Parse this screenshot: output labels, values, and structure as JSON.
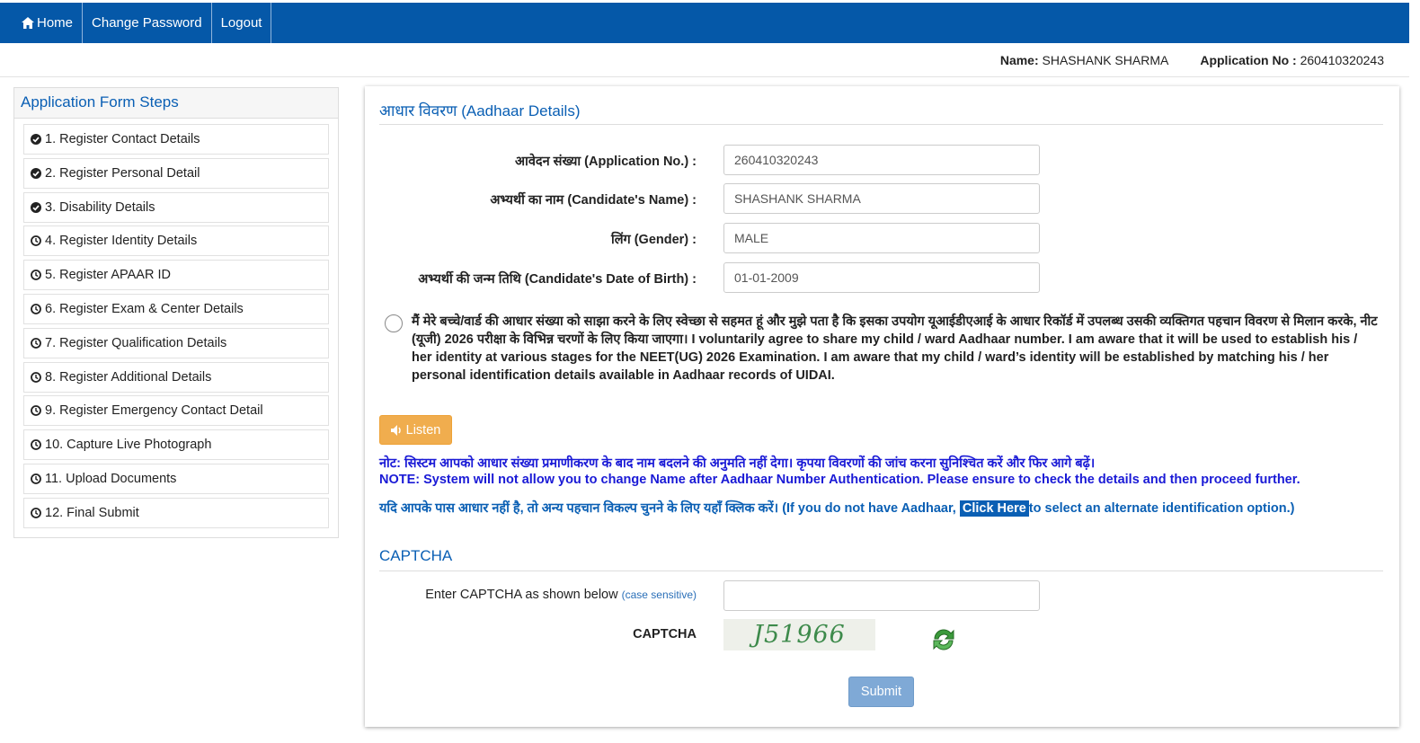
{
  "nav": {
    "home": "Home",
    "change_password": "Change Password",
    "logout": "Logout"
  },
  "user": {
    "name_label": "Name:",
    "name": "SHASHANK SHARMA",
    "app_label": "Application No :",
    "app_no": "260410320243"
  },
  "sidebar": {
    "title": "Application Form Steps",
    "steps": [
      {
        "label": "1. Register Contact Details",
        "status": "done"
      },
      {
        "label": "2. Register Personal Detail",
        "status": "done"
      },
      {
        "label": "3. Disability Details",
        "status": "done"
      },
      {
        "label": "4. Register Identity Details",
        "status": "pending"
      },
      {
        "label": "5. Register APAAR ID",
        "status": "pending"
      },
      {
        "label": "6. Register Exam & Center Details",
        "status": "pending"
      },
      {
        "label": "7. Register Qualification Details",
        "status": "pending"
      },
      {
        "label": "8. Register Additional Details",
        "status": "pending"
      },
      {
        "label": "9. Register Emergency Contact Detail",
        "status": "pending"
      },
      {
        "label": "10. Capture Live Photograph",
        "status": "pending"
      },
      {
        "label": "11. Upload Documents",
        "status": "pending"
      },
      {
        "label": "12. Final Submit",
        "status": "pending"
      }
    ]
  },
  "aadhaar": {
    "title_hi": "आधार विवरण",
    "title_en": "(Aadhaar Details)",
    "fields": [
      {
        "label_hi": "आवेदन संख्या",
        "label_en": "(Application No.) :",
        "value": "260410320243"
      },
      {
        "label_hi": "अभ्यर्थी का नाम",
        "label_en": "(Candidate's Name) :",
        "value": "SHASHANK SHARMA"
      },
      {
        "label_hi": "लिंग",
        "label_en": "(Gender) :",
        "value": "MALE"
      },
      {
        "label_hi": "अभ्यर्थी की जन्म तिथि",
        "label_en": "(Candidate's Date of Birth) :",
        "value": "01-01-2009"
      }
    ],
    "consent": "मैं मेरे बच्चे/वार्ड की आधार संख्या को साझा करने के लिए स्वेच्छा से सहमत हूं और मुझे पता है कि इसका उपयोग यूआईडीएआई के आधार रिकॉर्ड में उपलब्ध उसकी व्यक्तिगत पहचान विवरण से मिलान करके, नीट (यूजी) 2026 परीक्षा के विभिन्न चरणों के लिए किया जाएगा। I voluntarily agree to share my child / ward Aadhaar number. I am aware that it will be used to establish his / her identity at various stages for the NEET(UG) 2026 Examination. I am aware that my child / ward’s identity will be established by matching his / her personal identification details available in Aadhaar records of UIDAI.",
    "listen": "Listen",
    "note_hi": "नोट: सिस्टम आपको आधार संख्या प्रमाणीकरण के बाद नाम बदलने की अनुमति नहीं देगा। कृपया विवरणों की जांच करना सुनिश्चित करें और फिर आगे बढ़ें।",
    "note_en": "NOTE: System will not allow you to change Name after Aadhaar Number Authentication. Please ensure to check the details and then proceed further.",
    "alt_pre": "यदि आपके पास आधार नहीं है, तो अन्य पहचान विकल्प चुनने के लिए यहाँ क्लिक करें। (If you do not have Aadhaar,",
    "alt_link": "Click Here",
    "alt_post": "to select an alternate identification option.)"
  },
  "captcha": {
    "title": "CAPTCHA",
    "enter_label": "Enter CAPTCHA as shown below",
    "case_note": "(case sensitive)",
    "label": "CAPTCHA",
    "image_text": "J51966",
    "submit": "Submit"
  },
  "colors": {
    "nav_bg": "#0558a8",
    "accent": "#0a5fb4",
    "listen_btn": "#f0ad4e",
    "note_text": "#1a1ad6",
    "submit_btn": "#7fa9d6"
  }
}
